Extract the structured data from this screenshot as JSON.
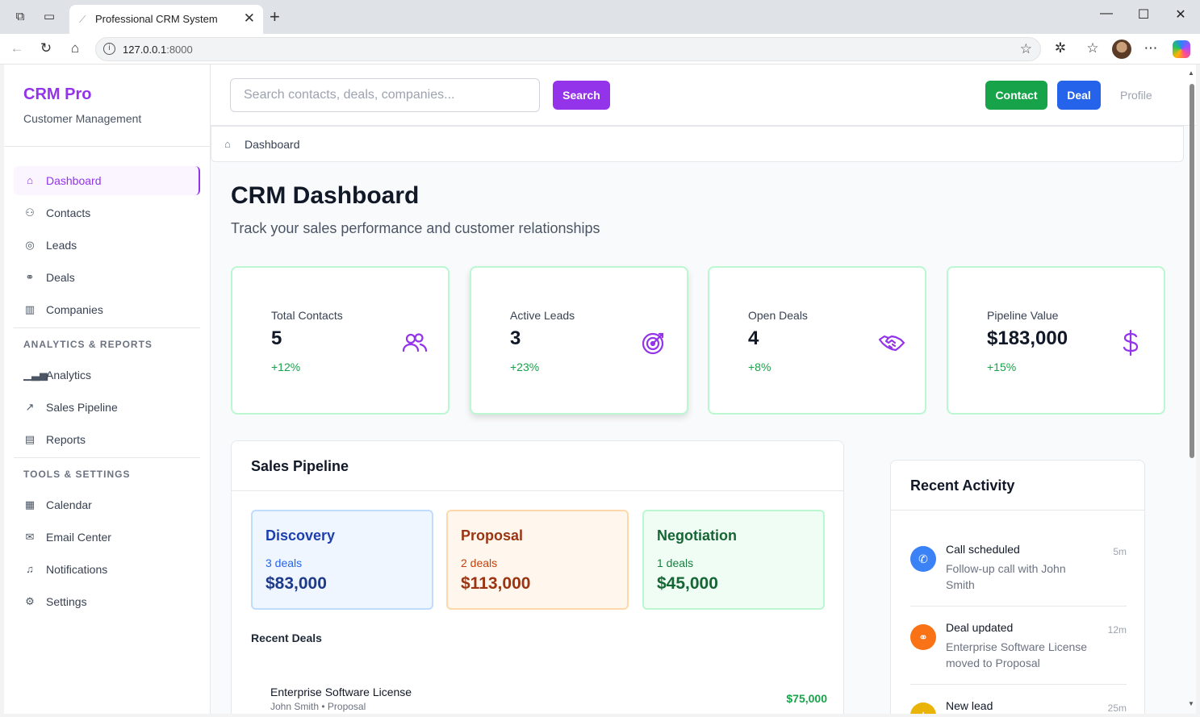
{
  "browser": {
    "tab_title": "Professional CRM System",
    "url_host": "127.0.0.1",
    "url_port": ":8000"
  },
  "sidebar": {
    "brand": "CRM Pro",
    "subtitle": "Customer Management",
    "items": [
      {
        "label": "Dashboard",
        "icon": "home-icon"
      },
      {
        "label": "Contacts",
        "icon": "users-icon"
      },
      {
        "label": "Leads",
        "icon": "target-icon"
      },
      {
        "label": "Deals",
        "icon": "handshake-icon"
      },
      {
        "label": "Companies",
        "icon": "building-icon"
      }
    ],
    "section_analytics": "ANALYTICS & REPORTS",
    "analytics_items": [
      {
        "label": "Analytics",
        "icon": "bar-chart-icon"
      },
      {
        "label": "Sales Pipeline",
        "icon": "trending-icon"
      },
      {
        "label": "Reports",
        "icon": "file-icon"
      }
    ],
    "section_tools": "TOOLS & SETTINGS",
    "tools_items": [
      {
        "label": "Calendar",
        "icon": "calendar-icon"
      },
      {
        "label": "Email Center",
        "icon": "mail-icon"
      },
      {
        "label": "Notifications",
        "icon": "bell-icon"
      },
      {
        "label": "Settings",
        "icon": "gear-icon"
      }
    ]
  },
  "topbar": {
    "search_placeholder": "Search contacts, deals, companies...",
    "search_button": "Search",
    "contact_button": "Contact",
    "deal_button": "Deal",
    "profile": "Profile"
  },
  "breadcrumb": {
    "label": "Dashboard"
  },
  "main": {
    "title": "CRM Dashboard",
    "subtitle": "Track your sales performance and customer relationships"
  },
  "stats": [
    {
      "label": "Total Contacts",
      "value": "5",
      "change": "+12%",
      "icon": "users-icon"
    },
    {
      "label": "Active Leads",
      "value": "3",
      "change": "+23%",
      "icon": "target-icon"
    },
    {
      "label": "Open Deals",
      "value": "4",
      "change": "+8%",
      "icon": "handshake-icon"
    },
    {
      "label": "Pipeline Value",
      "value": "$183,000",
      "change": "+15%",
      "icon": "dollar-icon"
    }
  ],
  "pipeline": {
    "title": "Sales Pipeline",
    "stages": [
      {
        "name": "Discovery",
        "count": "3 deals",
        "amount": "$83,000",
        "bg": "#eff6ff",
        "border": "#bfdbfe",
        "name_color": "#1e40af",
        "count_color": "#2563eb",
        "amount_color": "#1e3a8a"
      },
      {
        "name": "Proposal",
        "count": "2 deals",
        "amount": "$113,000",
        "bg": "#fff7ed",
        "border": "#fed7aa",
        "name_color": "#9a3412",
        "count_color": "#c2410c",
        "amount_color": "#9a3412"
      },
      {
        "name": "Negotiation",
        "count": "1 deals",
        "amount": "$45,000",
        "bg": "#f0fdf4",
        "border": "#bbf7d0",
        "name_color": "#166534",
        "count_color": "#15803d",
        "amount_color": "#166534"
      }
    ],
    "recent_deals_label": "Recent Deals",
    "deals": [
      {
        "title": "Enterprise Software License",
        "contact": "John Smith",
        "stage": "Proposal",
        "value": "$75,000"
      }
    ]
  },
  "activity": {
    "title": "Recent Activity",
    "items": [
      {
        "title": "Call scheduled",
        "desc": "Follow-up call with John Smith",
        "time": "5m",
        "color": "#3b82f6",
        "icon": "phone-icon"
      },
      {
        "title": "Deal updated",
        "desc": "Enterprise Software License moved to Proposal",
        "time": "12m",
        "color": "#f97316",
        "icon": "handshake-icon"
      },
      {
        "title": "New lead",
        "desc": "",
        "time": "25m",
        "color": "#eab308",
        "icon": "star-icon"
      }
    ]
  }
}
